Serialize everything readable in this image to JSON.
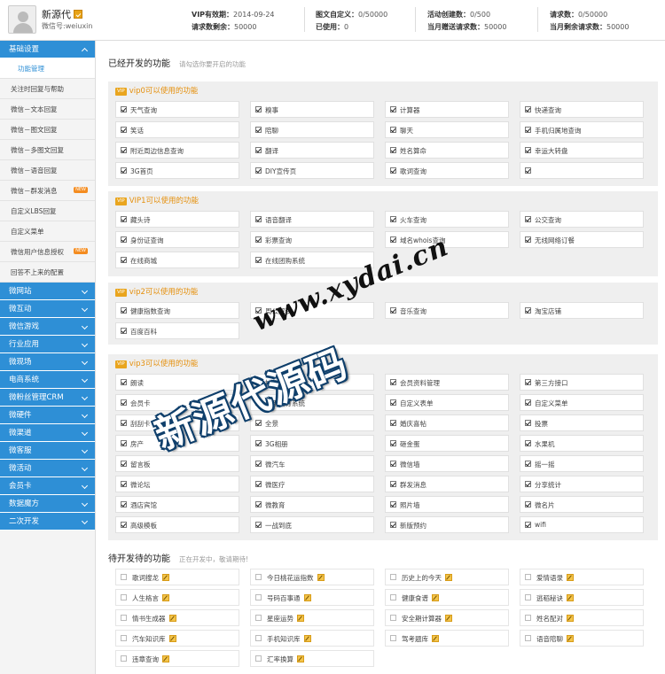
{
  "account": {
    "name": "新源代",
    "wechat_id": "微信号:weiuxin"
  },
  "stats": [
    {
      "label": "VIP有效期：",
      "value": "2014-09-24"
    },
    {
      "label": "请求数剩余：",
      "value": "50000"
    },
    {
      "label": "图文自定义：",
      "value": "0/50000"
    },
    {
      "label": "已使用：",
      "value": "0"
    },
    {
      "label": "活动创建数：",
      "value": "0/500"
    },
    {
      "label": "当月赠送请求数：",
      "value": "50000"
    },
    {
      "label": "请求数：",
      "value": "0/50000"
    },
    {
      "label": "当月剩余请求数：",
      "value": "50000"
    }
  ],
  "sidebar": {
    "basic": "基础设置",
    "sub_items": [
      {
        "label": "功能管理",
        "active": true,
        "new": false
      },
      {
        "label": "关注时回复与帮助",
        "active": false,
        "new": false
      },
      {
        "label": "微信－文本回复",
        "active": false,
        "new": false
      },
      {
        "label": "微信－图文回复",
        "active": false,
        "new": false
      },
      {
        "label": "微信－多图文回复",
        "active": false,
        "new": false
      },
      {
        "label": "微信－语音回复",
        "active": false,
        "new": false
      },
      {
        "label": "微信－群发消息",
        "active": false,
        "new": true
      },
      {
        "label": "自定义LBS回复",
        "active": false,
        "new": false
      },
      {
        "label": "自定义菜单",
        "active": false,
        "new": false
      },
      {
        "label": "微信用户信息授权",
        "active": false,
        "new": true
      },
      {
        "label": "回答不上来的配置",
        "active": false,
        "new": false
      }
    ],
    "new_tag": "NEW",
    "main_items": [
      "微网站",
      "微互动",
      "微信游戏",
      "行业应用",
      "微现场",
      "电商系统",
      "微粉丝管理CRM",
      "微硬件",
      "微渠道",
      "微客服",
      "微活动",
      "会员卡",
      "数据魔方",
      "二次开发"
    ]
  },
  "main": {
    "opened_title": "已经开发的功能",
    "opened_hint": "请勾选你要开启的功能",
    "vip_tag": "VIP",
    "groups": [
      {
        "title": "vip0可以使用的功能",
        "items": [
          "天气查询",
          "糗事",
          "计算器",
          "快递查询",
          "笑话",
          "陪聊",
          "聊天",
          "手机归属地查询",
          "附近周边信息查询",
          "翻译",
          "姓名算命",
          "幸运大转盘",
          "3G首页",
          "DIY宣传页",
          "歌词查询",
          ""
        ]
      },
      {
        "title": "VIP1可以使用的功能",
        "items": [
          "藏头诗",
          "语音翻译",
          "火车查询",
          "公交查询",
          "身份证查询",
          "彩票查询",
          "域名whois查询",
          "无线网络订餐",
          "在线商城",
          "在线团购系统"
        ]
      },
      {
        "title": "vip2可以使用的功能",
        "items": [
          "健康指数查询",
          "周公解梦",
          "音乐查询",
          "淘宝店铺",
          "百度百科"
        ]
      },
      {
        "title": "vip3可以使用的功能",
        "items": [
          "朗读",
          "抽奖",
          "会员资料管理",
          "第三方接口",
          "会员卡",
          "通用预订系统",
          "自定义表单",
          "自定义菜单",
          "刮刮卡",
          "全景",
          "婚庆喜帖",
          "投票",
          "房产",
          "3G相册",
          "砸金蛋",
          "水果机",
          "留言板",
          "微汽车",
          "微信墙",
          "摇一摇",
          "微论坛",
          "微医疗",
          "群发消息",
          "分享统计",
          "酒店宾馆",
          "微教育",
          "照片墙",
          "微名片",
          "高级模板",
          "一战到底",
          "新版预约",
          "wifi"
        ]
      }
    ],
    "pending_title": "待开发待的功能",
    "pending_hint": "正在开发中，敬请期待!",
    "pending_items": [
      "歌词搜龙",
      "今日桃花运指数",
      "历史上的今天",
      "爱情语录",
      "人生格言",
      "号码百事通",
      "健康食谱",
      "逃稻秘诀",
      "情书生成器",
      "星座运势",
      "安全期计算器",
      "姓名配对",
      "汽车知识库",
      "手机知识库",
      "驾考题库",
      "语音陪聊",
      "违章查询",
      "汇率换算"
    ]
  },
  "watermark": {
    "url": "www.xydai.cn",
    "text": "新源代源码"
  }
}
